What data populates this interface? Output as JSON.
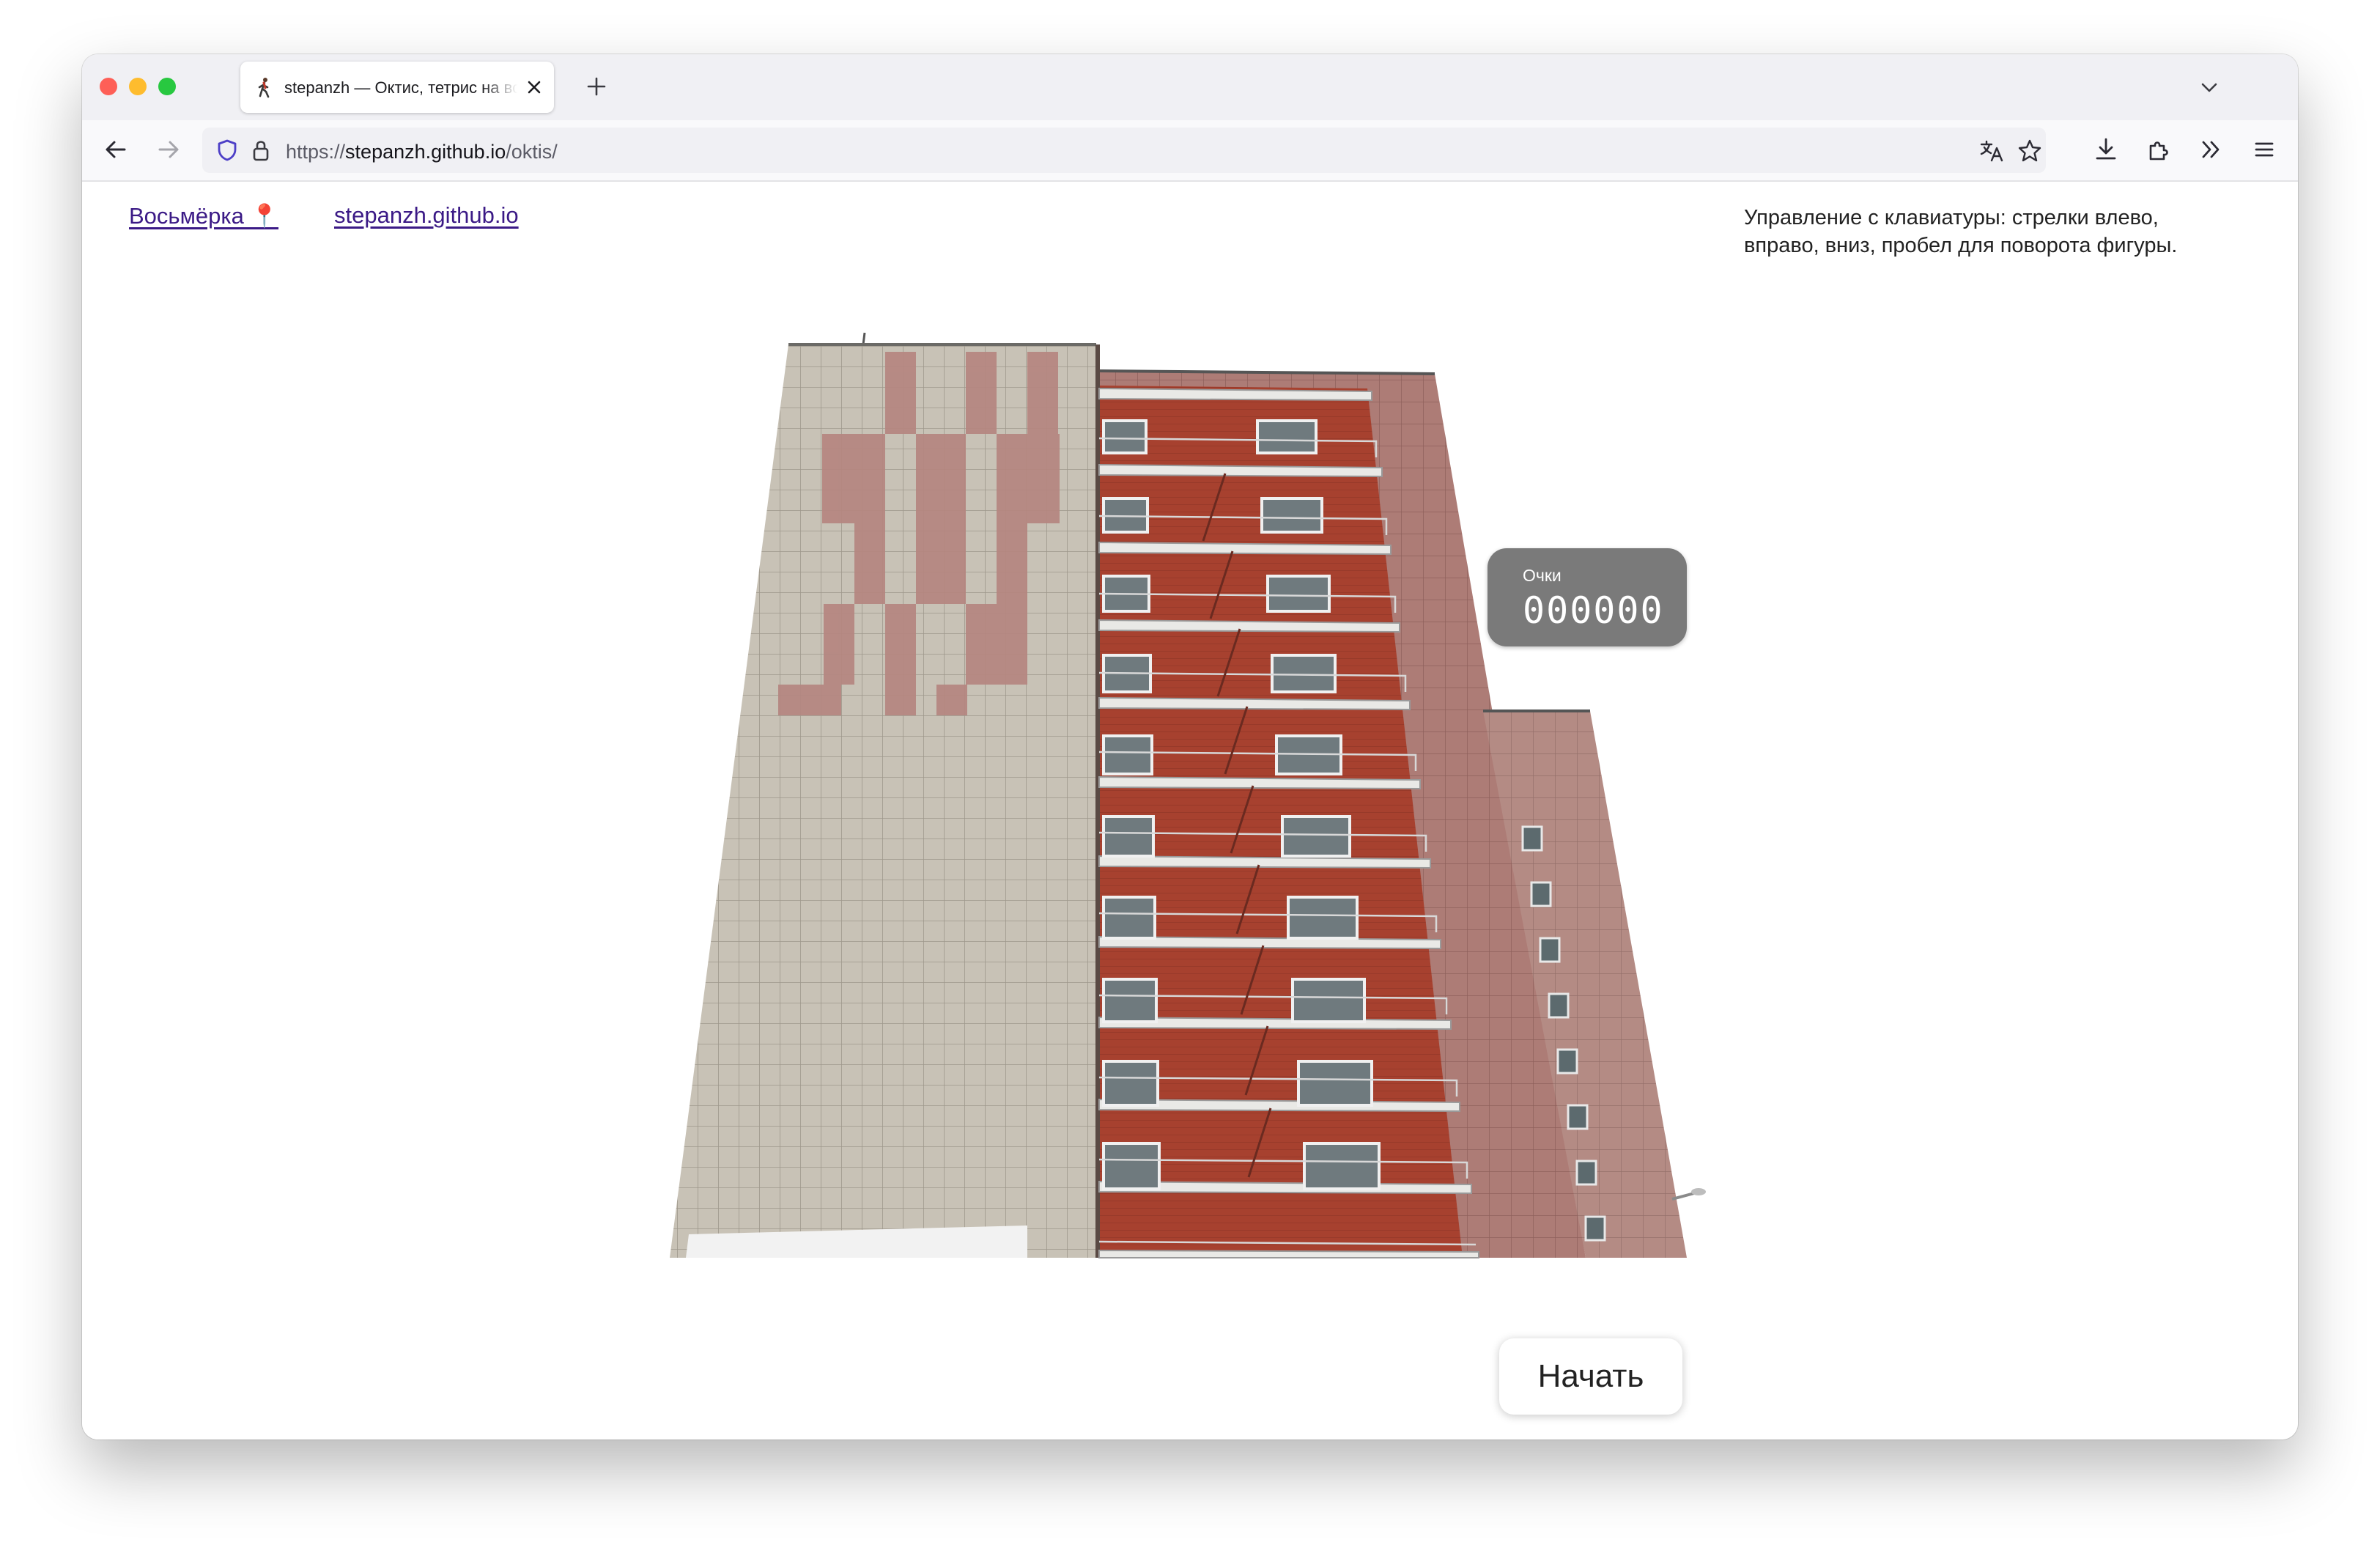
{
  "browser": {
    "tab": {
      "title": "stepanzh — Октис, тетрис на восьмёрке"
    },
    "url": {
      "scheme": "https://",
      "host": "stepanzh.github.io",
      "path": "/oktis/"
    },
    "icons": [
      "back-arrow-icon",
      "forward-arrow-icon",
      "shield-icon",
      "lock-icon",
      "translate-icon",
      "bookmark-star-icon",
      "download-icon",
      "extensions-icon",
      "overflow-chevrons-icon",
      "menu-icon",
      "new-tab-plus-icon",
      "tab-list-chevron-icon",
      "close-icon"
    ]
  },
  "page": {
    "links": {
      "vosmyorka": "Восьмёрка 📍",
      "home": "stepanzh.github.io"
    },
    "controls_help": "Управление с клавиатуры: стрелки влево, вправо, вниз, пробел для поворота фигуры.",
    "score": {
      "label": "Очки",
      "value": "000000"
    },
    "start_button": "Начать"
  },
  "colors": {
    "link": "#3b1a86",
    "score_badge": "#7a7a7a",
    "brick": "#a7412f",
    "tile_light": "#c8c2b6",
    "tile_pink": "#b9877f"
  }
}
